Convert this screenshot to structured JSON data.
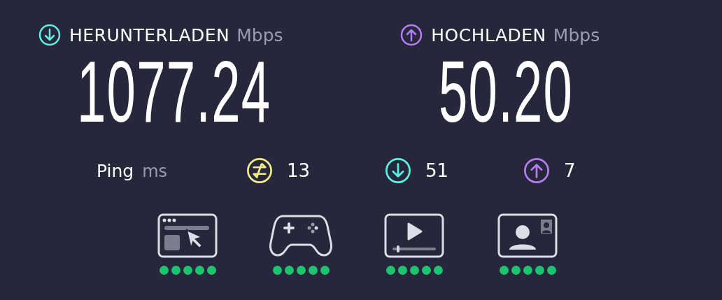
{
  "speeds": [
    {
      "kind": "download",
      "label": "HERUNTERLADEN",
      "unit": "Mbps",
      "value": "1077.24"
    },
    {
      "kind": "upload",
      "label": "HOCHLADEN",
      "unit": "Mbps",
      "value": "50.20"
    }
  ],
  "ping": {
    "label": "Ping",
    "unit": "ms",
    "stats": [
      {
        "kind": "jitter",
        "value": "13"
      },
      {
        "kind": "download",
        "value": "51"
      },
      {
        "kind": "upload",
        "value": "7"
      }
    ]
  },
  "activities": [
    {
      "kind": "browsing",
      "stars": 5
    },
    {
      "kind": "gaming",
      "stars": 5
    },
    {
      "kind": "streaming",
      "stars": 5
    },
    {
      "kind": "video-call",
      "stars": 5
    }
  ]
}
